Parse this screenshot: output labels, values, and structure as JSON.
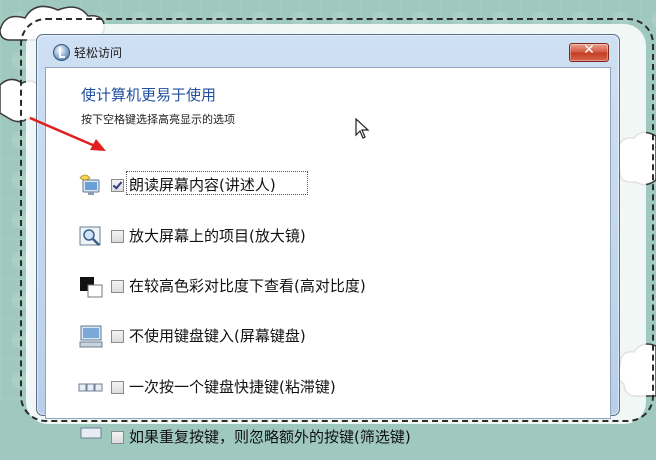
{
  "window": {
    "title": "轻松访问",
    "close_glyph": "✕"
  },
  "content": {
    "heading": "使计算机更易于使用",
    "subtext": "按下空格键选择高亮显示的选项"
  },
  "options": [
    {
      "label": "朗读屏幕内容(讲述人)",
      "checked": true,
      "icon": "narrator-icon"
    },
    {
      "label": "放大屏幕上的项目(放大镜)",
      "checked": false,
      "icon": "magnifier-icon"
    },
    {
      "label": "在较高色彩对比度下查看(高对比度)",
      "checked": false,
      "icon": "high-contrast-icon"
    },
    {
      "label": "不使用键盘键入(屏幕键盘)",
      "checked": false,
      "icon": "on-screen-keyboard-icon"
    },
    {
      "label": "一次按一个键盘快捷键(粘滞键)",
      "checked": false,
      "icon": "sticky-keys-icon"
    },
    {
      "label": "如果重复按键，则忽略额外的按键(筛选键)",
      "checked": false,
      "icon": "filter-keys-icon"
    }
  ],
  "colors": {
    "heading": "#1f4f9e",
    "arrow": "#e02020",
    "background": "#9fc9be"
  }
}
